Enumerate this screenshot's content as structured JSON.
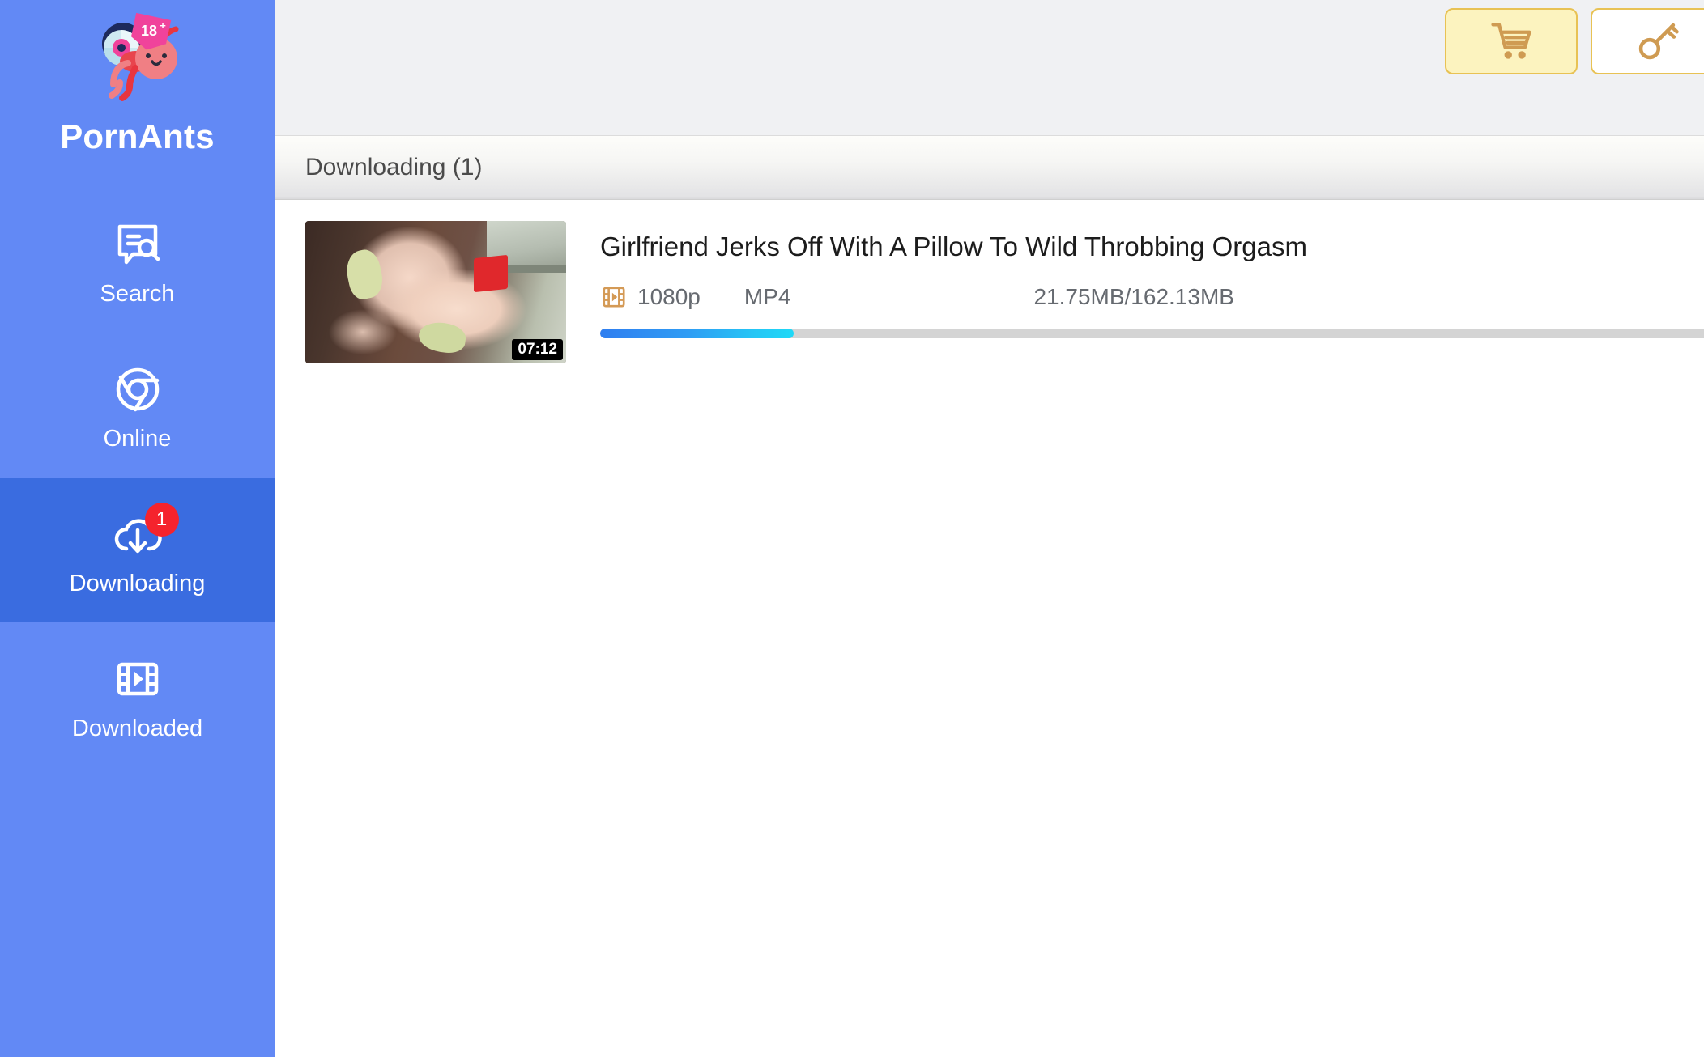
{
  "app": {
    "brand_name": "PornAnts",
    "logo_badge": "18+",
    "logo_icon": "ant-with-disc-logo"
  },
  "sidebar": {
    "items": [
      {
        "id": "search",
        "label": "Search",
        "icon": "search-chat-icon",
        "active": false,
        "badge": ""
      },
      {
        "id": "online",
        "label": "Online",
        "icon": "chrome-browser-icon",
        "active": false,
        "badge": ""
      },
      {
        "id": "downloading",
        "label": "Downloading",
        "icon": "cloud-download-icon",
        "active": true,
        "badge": "1"
      },
      {
        "id": "downloaded",
        "label": "Downloaded",
        "icon": "film-play-icon",
        "active": false,
        "badge": ""
      }
    ]
  },
  "topbar": {
    "buttons": [
      {
        "id": "cart",
        "icon": "shopping-cart-icon",
        "label": ""
      },
      {
        "id": "key",
        "icon": "key-icon",
        "label": ""
      }
    ],
    "accent_border": "#e8c254",
    "cart_fill": "#fcf3bf"
  },
  "tabs": [
    {
      "id": "downloading",
      "label": "Downloading (1)",
      "active": true
    }
  ],
  "downloads": [
    {
      "title": "Girlfriend Jerks Off With A Pillow To Wild Throbbing Orgasm",
      "duration": "07:12",
      "quality": "1080p",
      "quality_icon": "film-play-icon",
      "format": "MP4",
      "size": "21.75MB/162.13MB",
      "progress_percent": 13.4
    }
  ],
  "colors": {
    "sidebar_bg": "#6289f5",
    "sidebar_active_bg": "#3a6ce0",
    "badge_red": "#f5232d",
    "progress_start": "#2f7ef0",
    "progress_end": "#1fd9f7",
    "topbar_bg": "#f0f1f3"
  }
}
